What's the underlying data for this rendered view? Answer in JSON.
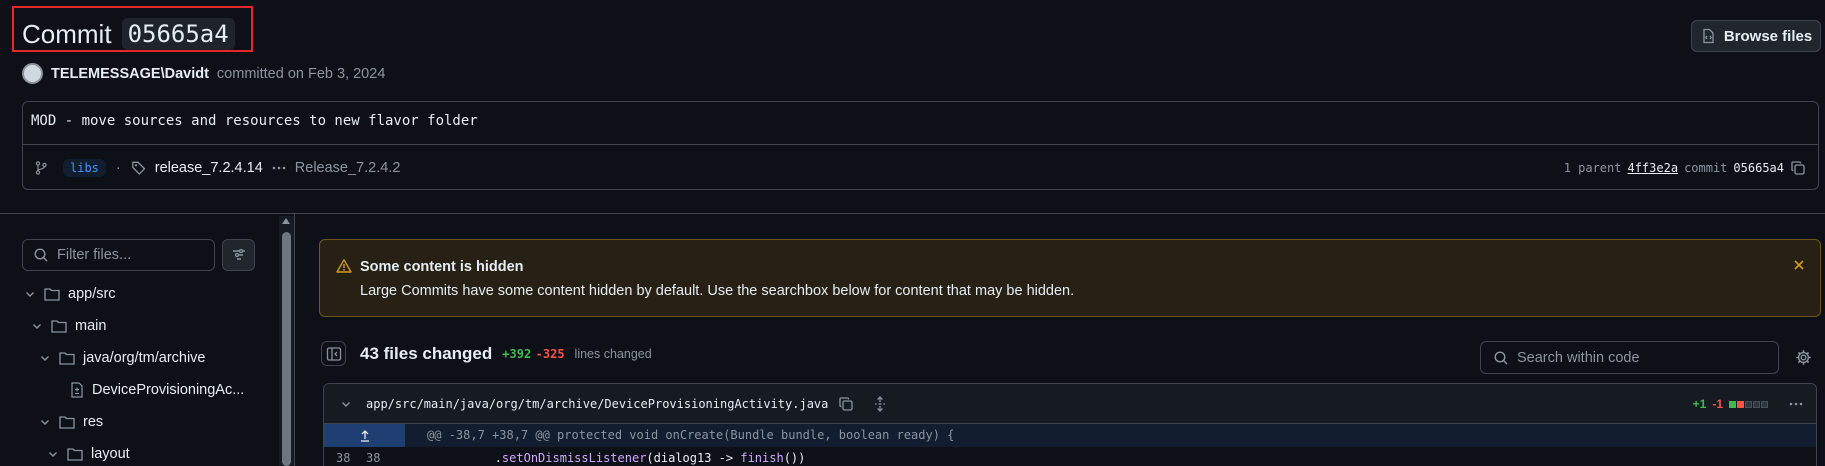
{
  "header": {
    "title_prefix": "Commit",
    "commit_hash": "05665a4",
    "browse_label": "Browse files"
  },
  "author": {
    "name": "TELEMESSAGE\\Davidt",
    "meta": "committed on Feb 3, 2024"
  },
  "commit": {
    "message": "MOD - move sources and resources to new flavor folder",
    "branch": "libs",
    "tag": "release_7.2.4.14",
    "tag_more": "Release_7.2.4.2",
    "parent_label": "1 parent",
    "parent_hash": "4ff3e2a",
    "commit_label": "commit",
    "commit_hash": "05665a4"
  },
  "sidebar": {
    "filter_placeholder": "Filter files...",
    "tree": [
      {
        "label": "app/src",
        "type": "folder"
      },
      {
        "label": "main",
        "type": "folder"
      },
      {
        "label": "java/org/tm/archive",
        "type": "folder"
      },
      {
        "label": "DeviceProvisioningAc...",
        "type": "file"
      },
      {
        "label": "res",
        "type": "folder"
      },
      {
        "label": "layout",
        "type": "folder"
      }
    ]
  },
  "warning": {
    "title": "Some content is hidden",
    "body": "Large Commits have some content hidden by default. Use the searchbox below for content that may be hidden."
  },
  "files_changed": {
    "title": "43 files changed",
    "additions": "+392",
    "deletions": "-325",
    "label": "lines changed",
    "search_placeholder": "Search within code"
  },
  "diff": {
    "path": "app/src/main/java/org/tm/archive/DeviceProvisioningActivity.java",
    "additions": "+1",
    "deletions": "-1",
    "hunk_header": "@@ -38,7 +38,7 @@ protected void onCreate(Bundle bundle, boolean ready) {",
    "lines": [
      {
        "old": "38",
        "new": "38",
        "prefix": "            .",
        "fn1": "setOnDismissListener",
        "mid": "(dialog13 -> ",
        "fn2": "finish",
        "suffix": "())"
      }
    ]
  },
  "colors": {
    "background": "#0d1117",
    "accent": "#4493f8",
    "added": "#3fb950",
    "deleted": "#f85149",
    "warning": "#d29922",
    "highlight_box": "#e5262b"
  }
}
